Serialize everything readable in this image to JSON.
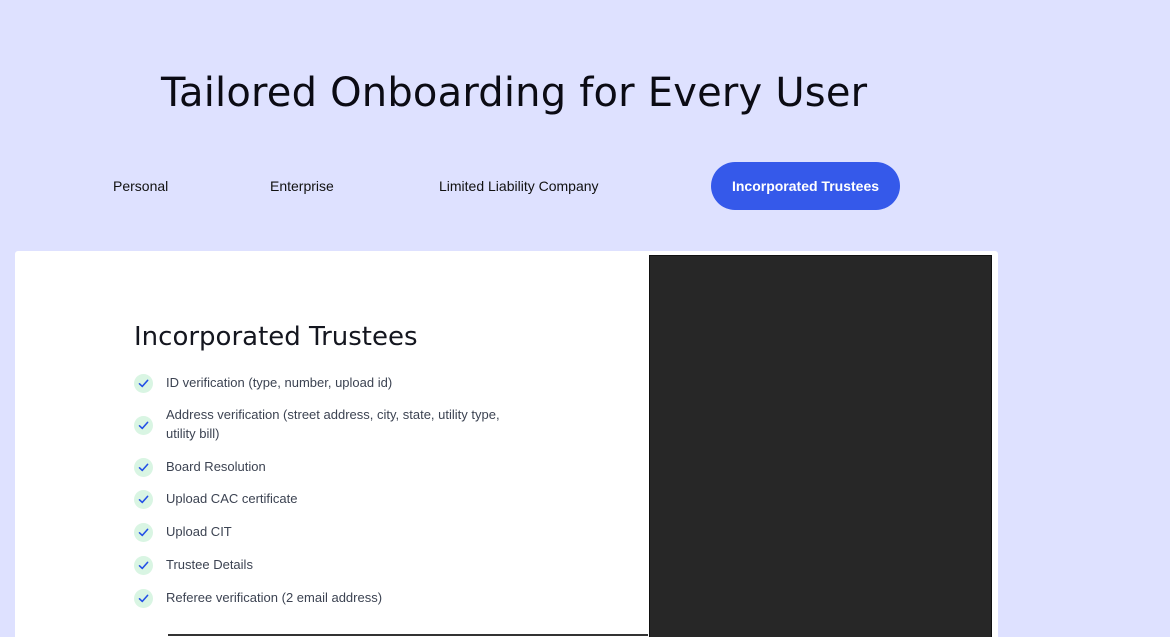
{
  "headline": "Tailored Onboarding for Every User",
  "tabs": [
    {
      "label": "Personal",
      "active": false
    },
    {
      "label": "Enterprise",
      "active": false
    },
    {
      "label": "Limited Liability Company",
      "active": false
    },
    {
      "label": "Incorporated Trustees",
      "active": true
    }
  ],
  "card": {
    "title": "Incorporated Trustees",
    "features": [
      "ID verification (type, number, upload id)",
      "Address verification (street address, city, state, utility type, utility bill)",
      "Board Resolution",
      "Upload CAC certificate",
      "Upload CIT",
      "Trustee Details",
      "Referee verification (2 email address)"
    ]
  },
  "colors": {
    "background": "#dee1ff",
    "accent": "#3559ea",
    "check_bg": "#d9f5e3",
    "check_mark": "#2350e6",
    "media_bg": "#272727"
  }
}
